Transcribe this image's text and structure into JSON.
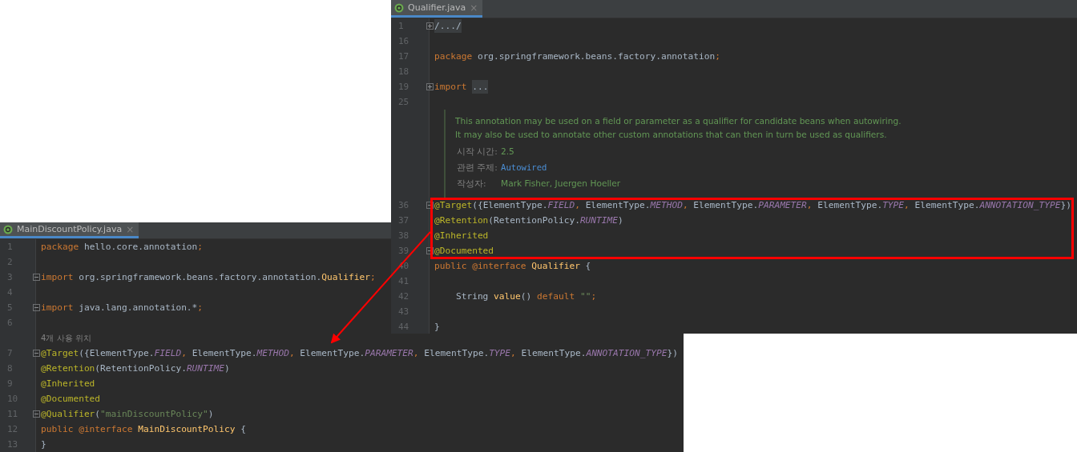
{
  "qualifier_editor": {
    "tab": {
      "title": "Qualifier.java",
      "close": "×",
      "selected": true
    },
    "lines_before_doc": [
      {
        "number": "1",
        "fold_marker": true,
        "collapsed": true,
        "tokens": [
          {
            "kind": "folded",
            "text": "/.../"
          }
        ]
      },
      {
        "number": "16"
      },
      {
        "number": "17",
        "tokens": [
          {
            "kind": "keyword",
            "text": "package"
          },
          {
            "kind": "plain",
            "text": " org.springframework.beans.factory.annotation"
          },
          {
            "kind": "keyword",
            "text": ";"
          }
        ]
      },
      {
        "number": "18"
      },
      {
        "number": "19",
        "fold_marker": true,
        "collapsed": true,
        "tokens": [
          {
            "kind": "keyword",
            "text": "import "
          },
          {
            "kind": "folded",
            "text": "..."
          }
        ]
      },
      {
        "number": "25"
      }
    ],
    "doc": {
      "paragraph": [
        "This annotation may be used on a field or parameter as a qualifier for candidate beans when autowiring.",
        "It may also be used to annotate other custom annotations that can then in turn be used as qualifiers."
      ],
      "tags": [
        {
          "label": "시작 시간:",
          "value": "2.5",
          "kind": "text"
        },
        {
          "label": "관련 주제:",
          "value": "Autowired",
          "kind": "link"
        },
        {
          "label": "작성자:",
          "value": "Mark Fisher, Juergen Hoeller",
          "kind": "text"
        }
      ]
    },
    "lines_after_doc": [
      {
        "number": "36",
        "fold_marker": true,
        "collapsed": false,
        "tokens": [
          {
            "kind": "annotation",
            "text": "@Target"
          },
          {
            "kind": "plain",
            "text": "({ElementType."
          },
          {
            "kind": "constant",
            "text": "FIELD"
          },
          {
            "kind": "keyword",
            "text": ","
          },
          {
            "kind": "plain",
            "text": " ElementType."
          },
          {
            "kind": "constant",
            "text": "METHOD"
          },
          {
            "kind": "keyword",
            "text": ","
          },
          {
            "kind": "plain",
            "text": " ElementType."
          },
          {
            "kind": "constant",
            "text": "PARAMETER"
          },
          {
            "kind": "keyword",
            "text": ","
          },
          {
            "kind": "plain",
            "text": " ElementType."
          },
          {
            "kind": "constant",
            "text": "TYPE"
          },
          {
            "kind": "keyword",
            "text": ","
          },
          {
            "kind": "plain",
            "text": " ElementType."
          },
          {
            "kind": "constant",
            "text": "ANNOTATION_TYPE"
          },
          {
            "kind": "plain",
            "text": "})"
          }
        ]
      },
      {
        "number": "37",
        "tokens": [
          {
            "kind": "annotation",
            "text": "@Retention"
          },
          {
            "kind": "plain",
            "text": "(RetentionPolicy."
          },
          {
            "kind": "constant",
            "text": "RUNTIME"
          },
          {
            "kind": "plain",
            "text": ")"
          }
        ]
      },
      {
        "number": "38",
        "tokens": [
          {
            "kind": "annotation",
            "text": "@Inherited"
          }
        ]
      },
      {
        "number": "39",
        "fold_marker": true,
        "collapsed": false,
        "tokens": [
          {
            "kind": "annotation",
            "text": "@Documented"
          }
        ]
      },
      {
        "number": "40",
        "tokens": [
          {
            "kind": "keyword",
            "text": "public @interface "
          },
          {
            "kind": "declname",
            "text": "Qualifier"
          },
          {
            "kind": "plain",
            "text": " {"
          }
        ]
      },
      {
        "number": "41"
      },
      {
        "number": "42",
        "tokens": [
          {
            "kind": "plain",
            "text": "    String "
          },
          {
            "kind": "declname",
            "text": "value"
          },
          {
            "kind": "plain",
            "text": "() "
          },
          {
            "kind": "keyword",
            "text": "default "
          },
          {
            "kind": "string",
            "text": "\"\""
          },
          {
            "kind": "keyword",
            "text": ";"
          }
        ]
      },
      {
        "number": "43"
      },
      {
        "number": "44",
        "tokens": [
          {
            "kind": "plain",
            "text": "}"
          }
        ]
      }
    ]
  },
  "main_discount_editor": {
    "tab": {
      "title": "MainDiscountPolicy.java",
      "close": "×",
      "selected": true
    },
    "lines": [
      {
        "number": "1",
        "tokens": [
          {
            "kind": "keyword",
            "text": "package"
          },
          {
            "kind": "plain",
            "text": " hello.core.annotation"
          },
          {
            "kind": "keyword",
            "text": ";"
          }
        ]
      },
      {
        "number": "2"
      },
      {
        "number": "3",
        "fold_marker": true,
        "collapsed": false,
        "tokens": [
          {
            "kind": "keyword",
            "text": "import"
          },
          {
            "kind": "plain",
            "text": " org.springframework.beans.factory.annotation."
          },
          {
            "kind": "declname",
            "text": "Qualifier"
          },
          {
            "kind": "keyword",
            "text": ";"
          }
        ]
      },
      {
        "number": "4"
      },
      {
        "number": "5",
        "fold_marker": true,
        "collapsed": false,
        "tokens": [
          {
            "kind": "keyword",
            "text": "import"
          },
          {
            "kind": "plain",
            "text": " java.lang.annotation.*"
          },
          {
            "kind": "keyword",
            "text": ";"
          }
        ]
      },
      {
        "number": "6"
      },
      {
        "kind": "usage_hint",
        "text": "4개 사용 위치"
      },
      {
        "number": "7",
        "fold_marker": true,
        "collapsed": false,
        "tokens": [
          {
            "kind": "annotation",
            "text": "@Target"
          },
          {
            "kind": "plain",
            "text": "({ElementType."
          },
          {
            "kind": "constant",
            "text": "FIELD"
          },
          {
            "kind": "keyword",
            "text": ","
          },
          {
            "kind": "plain",
            "text": " ElementType."
          },
          {
            "kind": "constant",
            "text": "METHOD"
          },
          {
            "kind": "keyword",
            "text": ","
          },
          {
            "kind": "plain",
            "text": " ElementType."
          },
          {
            "kind": "constant",
            "text": "PARAMETER"
          },
          {
            "kind": "keyword",
            "text": ","
          },
          {
            "kind": "plain",
            "text": " ElementType."
          },
          {
            "kind": "constant",
            "text": "TYPE"
          },
          {
            "kind": "keyword",
            "text": ","
          },
          {
            "kind": "plain",
            "text": " ElementType."
          },
          {
            "kind": "constant",
            "text": "ANNOTATION_TYPE"
          },
          {
            "kind": "plain",
            "text": "})"
          }
        ]
      },
      {
        "number": "8",
        "tokens": [
          {
            "kind": "annotation",
            "text": "@Retention"
          },
          {
            "kind": "plain",
            "text": "(RetentionPolicy."
          },
          {
            "kind": "constant",
            "text": "RUNTIME"
          },
          {
            "kind": "plain",
            "text": ")"
          }
        ]
      },
      {
        "number": "9",
        "tokens": [
          {
            "kind": "annotation",
            "text": "@Inherited"
          }
        ]
      },
      {
        "number": "10",
        "tokens": [
          {
            "kind": "annotation",
            "text": "@Documented"
          }
        ]
      },
      {
        "number": "11",
        "fold_marker": true,
        "collapsed": false,
        "tokens": [
          {
            "kind": "annotation",
            "text": "@Qualifier"
          },
          {
            "kind": "plain",
            "text": "("
          },
          {
            "kind": "string",
            "text": "\"mainDiscountPolicy\""
          },
          {
            "kind": "plain",
            "text": ")"
          }
        ]
      },
      {
        "number": "12",
        "tokens": [
          {
            "kind": "keyword",
            "text": "public @interface "
          },
          {
            "kind": "declname",
            "text": "MainDiscountPolicy"
          },
          {
            "kind": "plain",
            "text": " {"
          }
        ]
      },
      {
        "number": "13",
        "tokens": [
          {
            "kind": "plain",
            "text": "}"
          }
        ]
      }
    ]
  }
}
